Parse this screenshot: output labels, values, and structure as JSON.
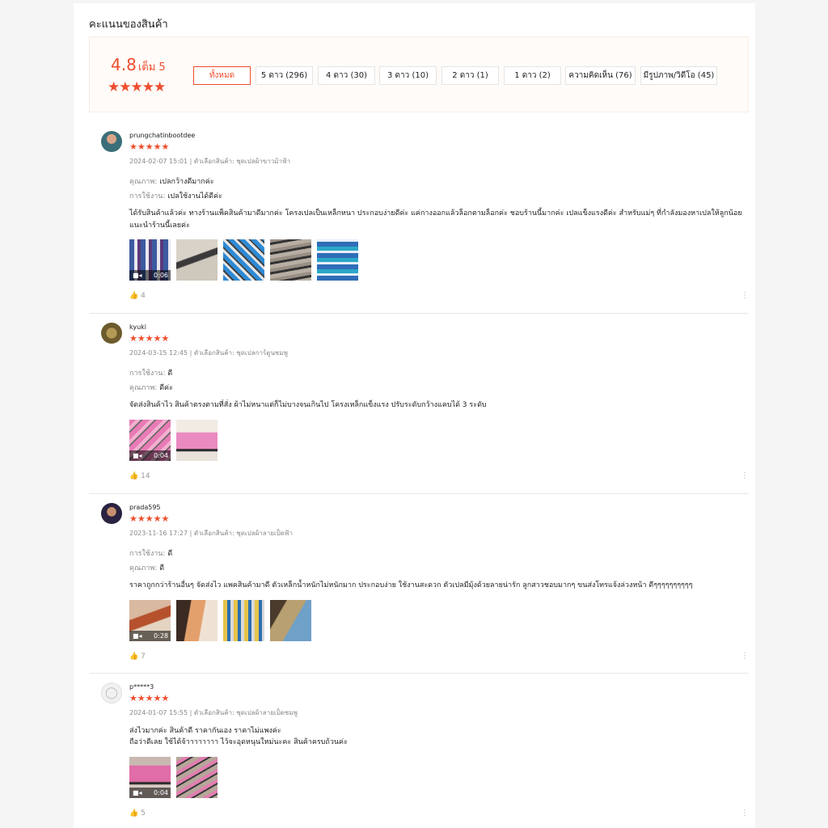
{
  "section_title": "คะแนนของสินค้า",
  "overview": {
    "score": "4.8",
    "score_suffix": "เต็ม 5",
    "stars": "★★★★★",
    "filters": [
      "ทั้งหมด",
      "5 ดาว (296)",
      "4 ดาว (30)",
      "3 ดาว (10)",
      "2 ดาว (1)",
      "1 ดาว (2)",
      "ความคิดเห็น (76)",
      "มีรูปภาพ/วิดีโอ (45)"
    ],
    "active_filter": "ทั้งหมด"
  },
  "colors": {
    "accent": "#ee4d2d",
    "overview_bg": "#fffbf8",
    "muted": "#888888"
  },
  "reviews": [
    {
      "username": "prungchatinbootdee",
      "stars": "★★★★★",
      "meta": "2024-02-07 15:01 | ตัวเลือกสินค้า: ชุดเปลผ้าขาวม้าฟ้า",
      "attr1_key": "คุณภาพ:",
      "attr1_val": "เปลกว้างดีมากค่ะ",
      "attr2_key": "การใช้งาน:",
      "attr2_val": "เปลใช้งานได้ดีค่ะ",
      "text": "ได้รับสินค้าแล้วค่ะ ทางร้านแพ็คสินค้ามาดีมากค่ะ โครงเปลเป็นเหล็กหนา ประกอบง่ายดีค่ะ แค่กางออกแล้วล็อกตามล็อกค่ะ ชอบร้านนี้มากค่ะ เปลแข็งแรงดีค่ะ สำหรับแม่ๆ ที่กำลังมองหาเปลให้ลูกน้อยแนะนำร้านนี้เลยค่ะ",
      "video_duration": "0:06",
      "likes": "4"
    },
    {
      "username": "kyuki",
      "stars": "★★★★★",
      "meta": "2024-03-15 12:45 | ตัวเลือกสินค้า: ชุดเปลการ์ตูนชมพู",
      "attr1_key": "การใช้งาน:",
      "attr1_val": "ดี",
      "attr2_key": "คุณภาพ:",
      "attr2_val": "ดีค่ะ",
      "text": "จัดส่งสินค้าไว สินค้าตรงตามที่สั่ง ผ้าไม่หนาแต่ก็ไม่บางจนเกินไป โครงเหล็กแข็งแรง ปรับระดับกว้างแคบได้ 3 ระดับ",
      "video_duration": "0:04",
      "likes": "14"
    },
    {
      "username": "prada595",
      "stars": "★★★★★",
      "meta": "2023-11-16 17:27 | ตัวเลือกสินค้า: ชุดเปลผ้าลายเป็ดฟ้า",
      "attr1_key": "การใช้งาน:",
      "attr1_val": "ดี",
      "attr2_key": "คุณภาพ:",
      "attr2_val": "ดี",
      "text": "ราคาถูกกว่าร้านอื่นๆ จัดส่งไว แพคสินค้ามาดี ตัวเหล็กน้ำหนักไม่หนักมาก ประกอบง่าย ใช้งานสะดวก  ตัวเปลมีมุ้งด้วยลายน่ารัก ลูกสาวชอบมากๆ ขนส่งโทรแจ้งล่วงหน้า ดีๆๆๆๆๆๆๆๆๆๆ",
      "video_duration": "0:28",
      "likes": "7"
    },
    {
      "username": "p*****3",
      "stars": "★★★★★",
      "meta": "2024-01-07 15:55 | ตัวเลือกสินค้า: ชุดเปลผ้าลายเป็ดชมพู",
      "text_line1": "ส่งไวมากค่ะ สินค้าดี ราคากันเอง ราคาไม่แพงค่ะ",
      "text_line2": "ถือว่าดีเลย ใช้ได้จ้าาาาาาาา ไว้จะอุดหนุนใหม่นะคะ สินค้าครบถ้วนค่ะ",
      "video_duration": "0:04",
      "likes": "5"
    }
  ]
}
